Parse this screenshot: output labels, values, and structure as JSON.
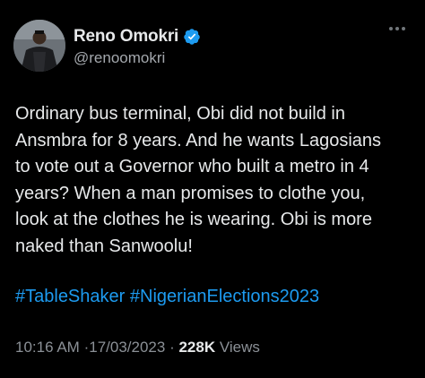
{
  "author": {
    "display_name": "Reno Omokri",
    "handle": "@renoomokri",
    "verified": true,
    "avatar": "avatar-photo",
    "verified_icon": "verified-badge-icon"
  },
  "menu": {
    "icon": "more-horizontal-icon"
  },
  "tweet": {
    "lines": [
      "Ordinary bus terminal, Obi did not build in",
      "Ansmbra for 8 years. And he wants Lagosians",
      "to vote out a Governor who built a metro in 4",
      "years? When a man promises to clothe you,",
      "look at the clothes he is wearing. Obi is more",
      "naked than Sanwoolu!"
    ],
    "hashtags": [
      "#TableShaker",
      "#NigerianElections2023"
    ]
  },
  "meta": {
    "time": "10:16 AM",
    "date": "17/03/2023",
    "separator": "·",
    "views_count": "228K",
    "views_label": "Views"
  },
  "colors": {
    "background": "#000000",
    "text": "#e7e9ea",
    "secondary": "#8b9096",
    "link": "#1d9bf0",
    "verified": "#1d9bf0"
  }
}
